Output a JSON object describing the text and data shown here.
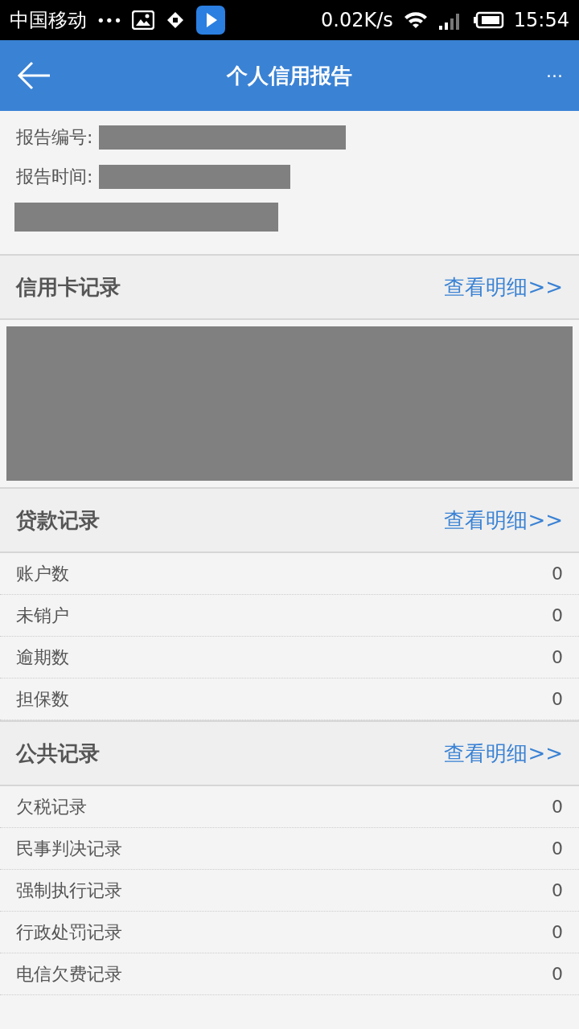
{
  "status_bar": {
    "carrier": "中国移动",
    "dots": "•••",
    "speed": "0.02K/s",
    "time": "15:54"
  },
  "header": {
    "title": "个人信用报告",
    "more": "···"
  },
  "report_info": [
    {
      "label": "报告编号:"
    },
    {
      "label": "报告时间:"
    }
  ],
  "sections": [
    {
      "kind": "redacted",
      "title": "信用卡记录",
      "link": "查看明细>>"
    },
    {
      "kind": "rows",
      "title": "贷款记录",
      "link": "查看明细>>",
      "rows": [
        {
          "label": "账户数",
          "value": "0"
        },
        {
          "label": "未销户",
          "value": "0"
        },
        {
          "label": "逾期数",
          "value": "0"
        },
        {
          "label": "担保数",
          "value": "0"
        }
      ]
    },
    {
      "kind": "rows",
      "title": "公共记录",
      "link": "查看明细>>",
      "rows": [
        {
          "label": "欠税记录",
          "value": "0"
        },
        {
          "label": "民事判决记录",
          "value": "0"
        },
        {
          "label": "强制执行记录",
          "value": "0"
        },
        {
          "label": "行政处罚记录",
          "value": "0"
        },
        {
          "label": "电信欠费记录",
          "value": "0"
        }
      ]
    }
  ]
}
